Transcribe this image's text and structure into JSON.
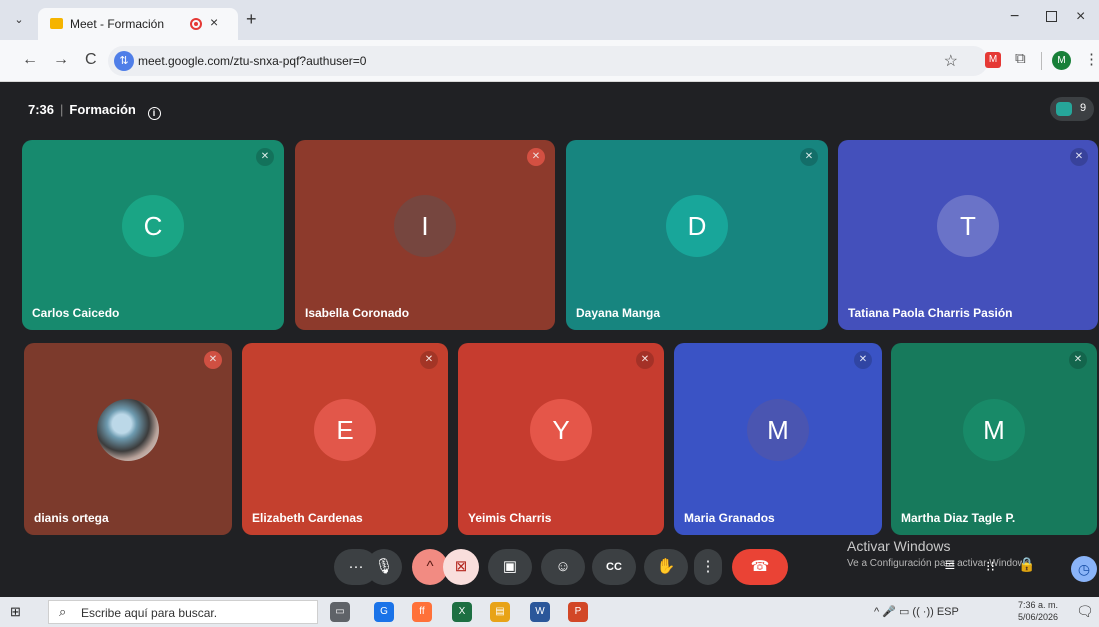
{
  "browser": {
    "tab_title": "Meet - Formación",
    "tab_close": "×",
    "new_tab": "+",
    "url": "meet.google.com/ztu-snxa-pqf?authuser=0",
    "profile_initial": "M",
    "win_min": "−",
    "win_close": "×",
    "back": "←",
    "forward": "→",
    "reload": "C",
    "star": "☆",
    "menu": "⋮",
    "dropdown": "⌄"
  },
  "meeting": {
    "time": "7:36",
    "title": "Formación",
    "info_glyph": "i",
    "participant_count": "9"
  },
  "participants": [
    {
      "name": "Carlos Caicedo",
      "initial": "C",
      "bg": "#178a6e",
      "avatar": "#1aa585",
      "muted_badge": "dark"
    },
    {
      "name": "Isabella Coronado",
      "initial": "I",
      "bg": "#8d3a2c",
      "avatar": "#76463f",
      "muted_badge": "red"
    },
    {
      "name": "Dayana Manga",
      "initial": "D",
      "bg": "#17857f",
      "avatar": "#18a69a",
      "muted_badge": "dark"
    },
    {
      "name": "Tatiana Paola Charris Pasión",
      "initial": "T",
      "bg": "#4450bb",
      "avatar": "#6a73c8",
      "muted_badge": "dark"
    },
    {
      "name": "dianis ortega",
      "initial": "",
      "bg": "#7c3a2c",
      "avatar": "",
      "muted_badge": "red"
    },
    {
      "name": "Elizabeth Cardenas",
      "initial": "E",
      "bg": "#c4402e",
      "avatar": "#e2574a",
      "muted_badge": "dark"
    },
    {
      "name": "Yeimis Charris",
      "initial": "Y",
      "bg": "#c63c2f",
      "avatar": "#e55649",
      "muted_badge": "dark"
    },
    {
      "name": "Maria Granados",
      "initial": "M",
      "bg": "#3a53c5",
      "avatar": "#4a55b1",
      "muted_badge": "dark"
    },
    {
      "name": "Martha Diaz Tagle P.",
      "initial": "M",
      "bg": "#177a5c",
      "avatar": "#188a68",
      "muted_badge": "dark"
    }
  ],
  "controls": {
    "more": "···",
    "mic": "🎙",
    "cam_options": "^",
    "cam": "⊠",
    "present": "▣",
    "emoji": "☺",
    "captions": "CC",
    "raise_hand": "✋",
    "options": "⋮",
    "hangup": "☎"
  },
  "watermark": {
    "line1": "Activar Windows",
    "line2": "Ve a Configuración para activar Windows."
  },
  "side_icons": {
    "chat": "≣",
    "grid": "⁝⁝",
    "lock": "🔒",
    "timer": "◷"
  },
  "taskbar": {
    "start": "⊞",
    "search_placeholder": "Escribe aquí para buscar.",
    "search_glyph": "⌕",
    "apps": [
      {
        "label": "▭",
        "color": "#5f6368"
      },
      {
        "label": "G",
        "color": "#1a73e8"
      },
      {
        "label": "ff",
        "color": "#ff7139"
      },
      {
        "label": "X",
        "color": "#1d6f42"
      },
      {
        "label": "▤",
        "color": "#e8a317"
      },
      {
        "label": "W",
        "color": "#2b579a"
      },
      {
        "label": "P",
        "color": "#d24726"
      }
    ],
    "tray": "^ 🎤 ▭ ((  ·)) ESP",
    "time": "7:36 a. m.",
    "date": "5/06/2026",
    "notifications": "🗨"
  }
}
